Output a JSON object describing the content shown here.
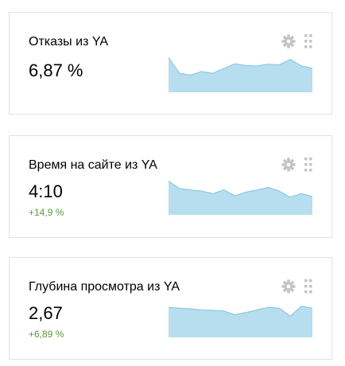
{
  "colors": {
    "spark_fill": "#b6deef",
    "spark_stroke": "#7fc3e2",
    "delta_positive": "#5a9a3a",
    "icon": "#c4c4c4"
  },
  "widgets": [
    {
      "title": "Отказы из YA",
      "value": "6,87 %",
      "delta": "",
      "icons": [
        "gear-icon",
        "drag-handle-icon"
      ],
      "sparkline": [
        0.95,
        0.52,
        0.47,
        0.57,
        0.52,
        0.65,
        0.78,
        0.73,
        0.72,
        0.77,
        0.75,
        0.9,
        0.72,
        0.66
      ]
    },
    {
      "title": "Время на сайте из YA",
      "value": "4:10",
      "delta": "+14,9 %",
      "icons": [
        "gear-icon",
        "drag-handle-icon"
      ],
      "sparkline": [
        0.92,
        0.72,
        0.68,
        0.65,
        0.58,
        0.68,
        0.52,
        0.62,
        0.68,
        0.75,
        0.65,
        0.48,
        0.58,
        0.5
      ]
    },
    {
      "title": "Глубина просмотра из YA",
      "value": "2,67",
      "delta": "+6,89 %",
      "icons": [
        "gear-icon",
        "drag-handle-icon"
      ],
      "sparkline": [
        0.82,
        0.8,
        0.78,
        0.75,
        0.74,
        0.72,
        0.62,
        0.68,
        0.75,
        0.82,
        0.8,
        0.58,
        0.85,
        0.8
      ]
    }
  ]
}
